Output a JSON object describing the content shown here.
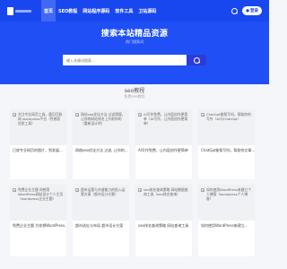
{
  "header": {
    "menu": [
      "首页",
      "SEO教程",
      "网站程序源码",
      "软件工具",
      "卫站源码"
    ],
    "login_label": "登录"
  },
  "hero": {
    "title": "搜索本站精品资源",
    "subtitle": "热门搜索词",
    "search_placeholder": "输入关键词搜索..."
  },
  "section": {
    "title": "seo教程",
    "subtitle": "免费seo教程"
  },
  "cards": [
    {
      "alt": "关注专业网页工具，重回互联网 wordpress平台（性感而优质工具）",
      "title": "已收专业网页的图片，到发展..."
    },
    {
      "alt": "网站seo优化方法 过滤需要，让你的网站排名上升前你的 （重新设计的）",
      "title": "网络seo优化方法 过滤, 让你的..."
    },
    {
      "alt": "AI写作免费，让内容创作更简单（AI写作，让内容创作更简单）",
      "title": "AI写作免费，让内容创作更简单"
    },
    {
      "alt": "ChatGpt能帮写吗，帮助你的写作（AI与ChatGpt）",
      "title": "ChatGpt能帮写吗，帮助你文章..."
    },
    {
      "alt": "免费企业主题 你想用WordPress网站设计个人主页（wordpress企业主题）",
      "title": "免费企业主题 为你想WordPress..."
    },
    {
      "alt": "超市运营与关键能力的投入运营方案（超市设计方案）",
      "title": "超市选址与布局 超市设计方案"
    },
    {
      "alt": "seo排名查询策略 网站数据查询工具（seo排名查询）",
      "title": "seo排名查询策略 网站查询工具"
    },
    {
      "alt": "如何使用WordPress来建立个人博客（wordpress个人博客）",
      "title": "如何使用WordPress来建立..."
    }
  ]
}
